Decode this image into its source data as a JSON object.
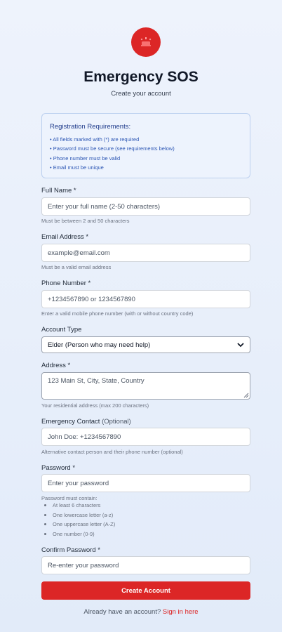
{
  "header": {
    "icon": "siren-icon",
    "title": "Emergency SOS",
    "subtitle": "Create your account"
  },
  "requirements": {
    "title": "Registration Requirements:",
    "items": [
      "• All fields marked with (*) are required",
      "• Password must be secure (see requirements below)",
      "• Phone number must be valid",
      "• Email must be unique"
    ]
  },
  "form": {
    "full_name": {
      "label": "Full Name *",
      "placeholder": "Enter your full name (2-50 characters)",
      "hint": "Must be between 2 and 50 characters"
    },
    "email": {
      "label": "Email Address *",
      "placeholder": "example@email.com",
      "hint": "Must be a valid email address"
    },
    "phone": {
      "label": "Phone Number *",
      "placeholder": "+1234567890 or 1234567890",
      "hint": "Enter a valid mobile phone number (with or without country code)"
    },
    "account_type": {
      "label": "Account Type",
      "selected": "Elder (Person who may need help)"
    },
    "address": {
      "label": "Address *",
      "placeholder": "123 Main St, City, State, Country",
      "hint": "Your residential address (max 200 characters)"
    },
    "emergency_contact": {
      "label": "Emergency Contact",
      "label_optional": "(Optional)",
      "placeholder": "John Doe: +1234567890",
      "hint": "Alternative contact person and their phone number (optional)"
    },
    "password": {
      "label": "Password *",
      "placeholder": "Enter your password",
      "hint": "Password must contain:",
      "rules": [
        "At least 6 characters",
        "One lowercase letter (a-z)",
        "One uppercase letter (A-Z)",
        "One number (0-9)"
      ]
    },
    "confirm_password": {
      "label": "Confirm Password *",
      "placeholder": "Re-enter your password"
    },
    "submit_label": "Create Account"
  },
  "footer": {
    "prompt": "Already have an account?",
    "link_label": "Sign in here"
  },
  "colors": {
    "accent": "#dc2626",
    "requirements_bg": "#edf3fd",
    "requirements_text": "#2c56b4"
  }
}
